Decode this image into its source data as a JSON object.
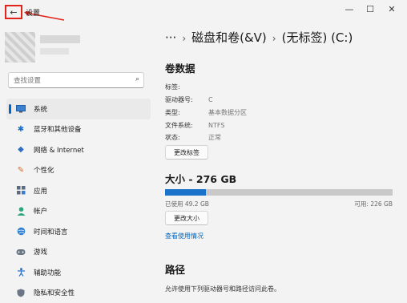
{
  "app": {
    "title": "设置"
  },
  "window_controls": {
    "minimize": "—",
    "maximize": "☐",
    "close": "✕"
  },
  "search": {
    "placeholder": "查找设置"
  },
  "sidebar": {
    "items": [
      {
        "label": "系统",
        "icon": "monitor-icon",
        "active": true
      },
      {
        "label": "蓝牙和其他设备",
        "icon": "bluetooth-icon"
      },
      {
        "label": "网络 & Internet",
        "icon": "wifi-icon"
      },
      {
        "label": "个性化",
        "icon": "brush-icon"
      },
      {
        "label": "应用",
        "icon": "apps-icon"
      },
      {
        "label": "帐户",
        "icon": "person-icon"
      },
      {
        "label": "时间和语言",
        "icon": "globe-icon"
      },
      {
        "label": "游戏",
        "icon": "gamepad-icon"
      },
      {
        "label": "辅助功能",
        "icon": "accessibility-icon"
      },
      {
        "label": "隐私和安全性",
        "icon": "shield-icon"
      }
    ]
  },
  "breadcrumb": {
    "more": "···",
    "parent": "磁盘和卷(&V)",
    "current": "(无标签) (C:)"
  },
  "volume": {
    "title": "卷数据",
    "fields": [
      {
        "key": "标签:",
        "value": ""
      },
      {
        "key": "驱动器号:",
        "value": "C"
      },
      {
        "key": "类型:",
        "value": "基本数据分区"
      },
      {
        "key": "文件系统:",
        "value": "NTFS"
      },
      {
        "key": "状态:",
        "value": "正常"
      }
    ],
    "change_label_button": "更改标签"
  },
  "size": {
    "title": "大小 - 276 GB",
    "used_label": "已使用 49.2 GB",
    "free_label": "可用: 226 GB",
    "used_fraction": 0.178,
    "resize_button": "更改大小",
    "usage_link": "查看使用情况"
  },
  "path": {
    "title": "路径",
    "description": "允许使用下列驱动器号和路径访问此卷。"
  },
  "colors": {
    "accent": "#0067c0",
    "bar_used": "#1a73c8",
    "annotation": "#e2231a"
  }
}
